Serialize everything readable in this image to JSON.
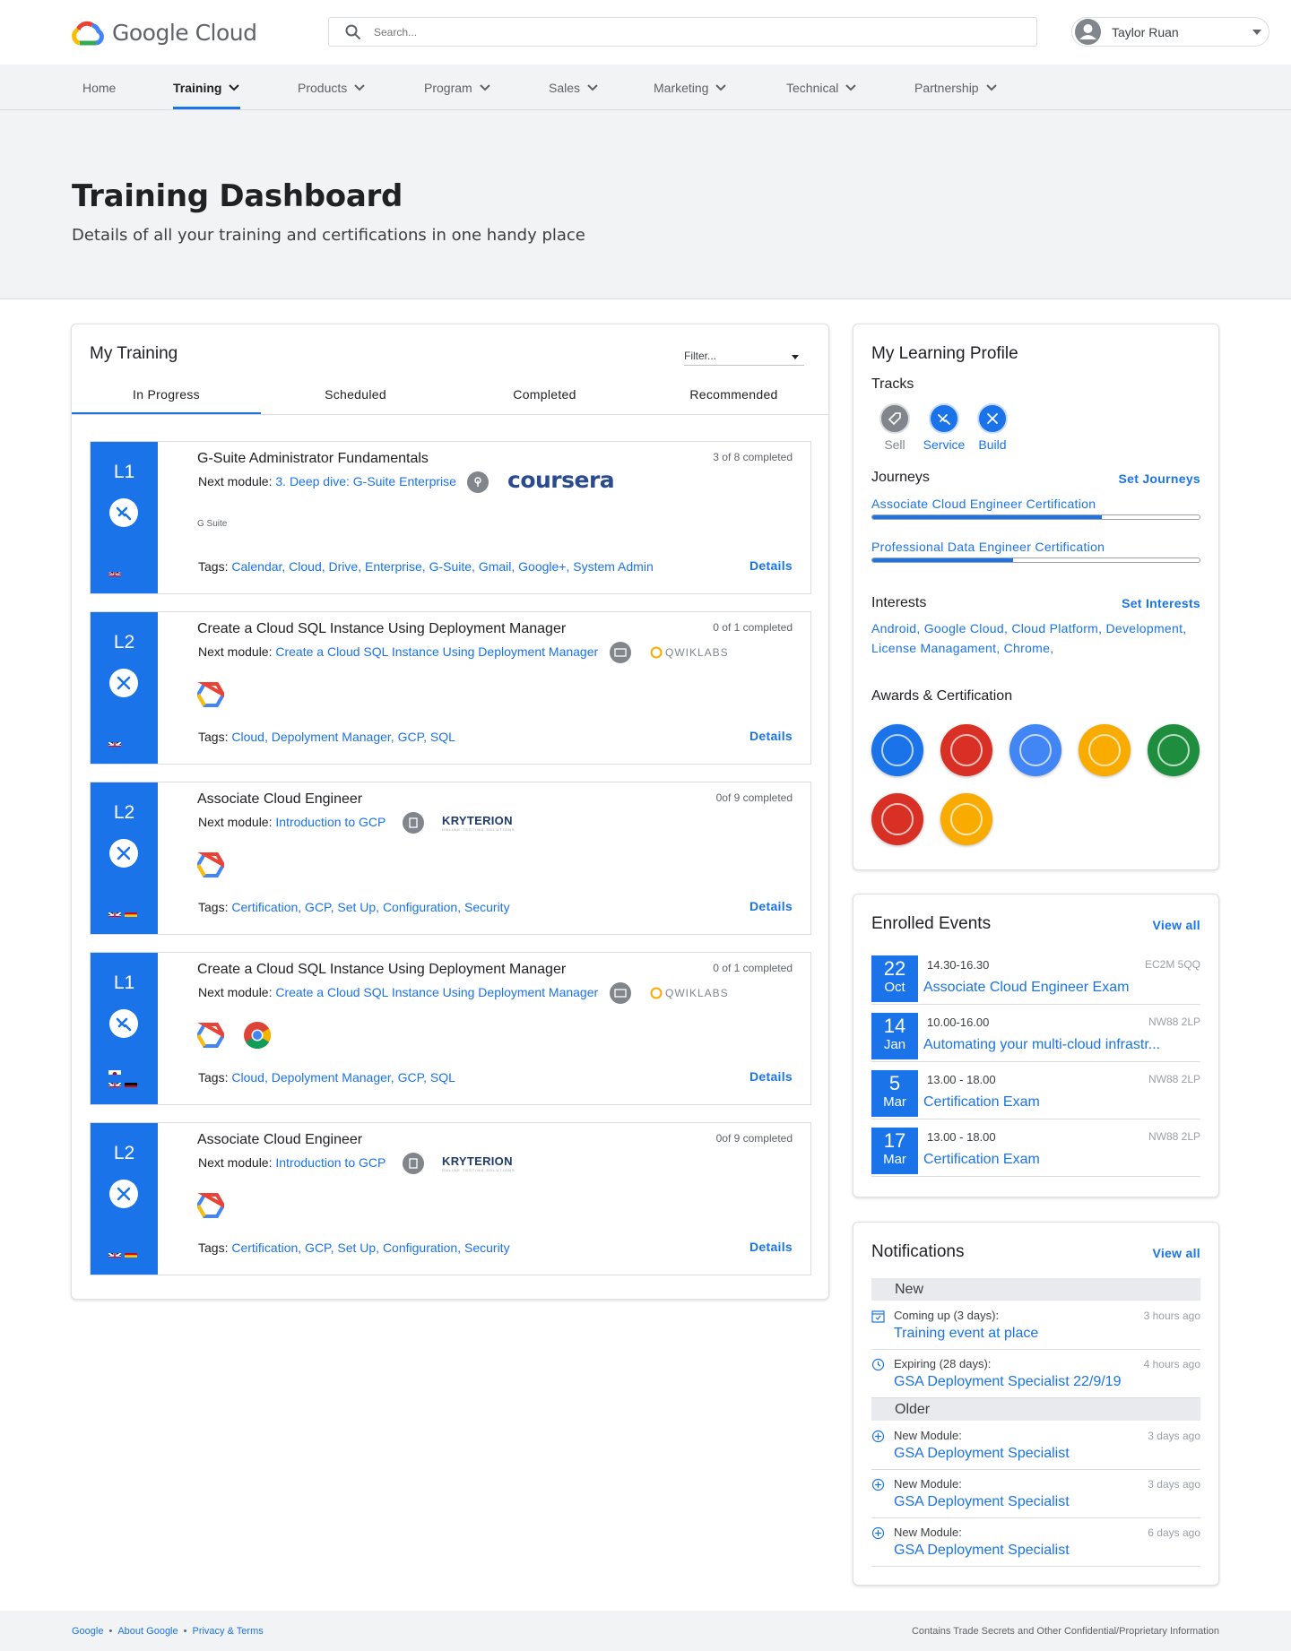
{
  "header": {
    "brand": "Google Cloud",
    "search_placeholder": "Search...",
    "user_name": "Taylor Ruan"
  },
  "nav": {
    "items": [
      {
        "label": "Home",
        "dropdown": false
      },
      {
        "label": "Training",
        "dropdown": true,
        "active": true
      },
      {
        "label": "Products",
        "dropdown": true
      },
      {
        "label": "Program",
        "dropdown": true
      },
      {
        "label": "Sales",
        "dropdown": true
      },
      {
        "label": "Marketing",
        "dropdown": true
      },
      {
        "label": "Technical",
        "dropdown": true
      },
      {
        "label": "Partnership",
        "dropdown": true
      }
    ]
  },
  "hero": {
    "title": "Training Dashboard",
    "subtitle": "Details of all your training and certifications in one handy place"
  },
  "my_training": {
    "title": "My Training",
    "filter_placeholder": "Filter...",
    "tabs": [
      "In Progress",
      "Scheduled",
      "Completed",
      "Recommended"
    ],
    "active_tab": "In Progress",
    "next_module_label": "Next module:",
    "tags_label": "Tags:",
    "details_label": "Details",
    "courses": [
      {
        "level": "L1",
        "title": "G-Suite Administrator Fundamentals",
        "next_module": "3. Deep dive: G-Suite Enterprise",
        "progress": "3 of 8 completed",
        "provider": "coursera",
        "product": "G Suite",
        "tags": "Calendar, Cloud, Drive, Enterprise, G-Suite, Gmail, Google+, System Admin"
      },
      {
        "level": "L2",
        "title": "Create a Cloud SQL Instance Using Deployment Manager",
        "next_module": "Create a Cloud SQL Instance Using Deployment Manager",
        "progress": "0 of 1 completed",
        "provider": "QWIKLABS",
        "tags": "Cloud, Depolyment Manager, GCP, SQL"
      },
      {
        "level": "L2",
        "title": "Associate Cloud Engineer",
        "next_module": "Introduction to GCP",
        "progress": "0of 9 completed",
        "provider": "KRYTERION",
        "provider_sub": "ONLINE TESTING SOLUTIONS",
        "tags": "Certification, GCP, Set Up, Configuration, Security"
      },
      {
        "level": "L1",
        "title": "Create a Cloud SQL Instance Using Deployment Manager",
        "next_module": "Create a Cloud SQL Instance Using Deployment Manager",
        "progress": "0 of 1 completed",
        "provider": "QWIKLABS",
        "tags": "Cloud, Depolyment Manager, GCP, SQL"
      },
      {
        "level": "L2",
        "title": "Associate Cloud Engineer",
        "next_module": "Introduction to GCP",
        "progress": "0of 9 completed",
        "provider": "KRYTERION",
        "provider_sub": "ONLINE TESTING SOLUTIONS",
        "tags": "Certification, GCP, Set Up, Configuration, Security"
      }
    ]
  },
  "learning_profile": {
    "title": "My Learning Profile",
    "tracks_label": "Tracks",
    "tracks": [
      {
        "label": "Sell",
        "active": false
      },
      {
        "label": "Service",
        "active": true
      },
      {
        "label": "Build",
        "active": true
      }
    ],
    "journeys_label": "Journeys",
    "set_journeys": "Set Journeys",
    "journeys": [
      {
        "name": "Associate Cloud Engineer Certification",
        "progress": 0.7
      },
      {
        "name": "Professional Data Engineer Certification",
        "progress": 0.43
      }
    ],
    "interests_label": "Interests",
    "set_interests": "Set Interests",
    "interests": "Android, Google Cloud, Cloud Platform, Development, License Managament, Chrome,",
    "awards_label": "Awards & Certification",
    "award_colors": [
      "#1a73e8",
      "#d93025",
      "#4285f4",
      "#f9ab00",
      "#1e8e3e",
      "#d93025",
      "#f9ab00"
    ]
  },
  "events": {
    "title": "Enrolled Events",
    "view_all": "View all",
    "items": [
      {
        "day": "22",
        "month": "Oct",
        "time": "14.30-16.30",
        "code": "EC2M 5QQ",
        "name": "Associate Cloud Engineer Exam"
      },
      {
        "day": "14",
        "month": "Jan",
        "time": "10.00-16.00",
        "code": "NW88 2LP",
        "name": "Automating your multi-cloud infrastr..."
      },
      {
        "day": "5",
        "month": "Mar",
        "time": "13.00 - 18.00",
        "code": "NW88 2LP",
        "name": "Certification Exam"
      },
      {
        "day": "17",
        "month": "Mar",
        "time": "13.00 - 18.00",
        "code": "NW88 2LP",
        "name": "Certification Exam"
      }
    ]
  },
  "notifications": {
    "title": "Notifications",
    "view_all": "View all",
    "new_label": "New",
    "older_label": "Older",
    "new_items": [
      {
        "icon": "calendar-icon",
        "title": "Coming up (3 days):",
        "link": "Training event at place",
        "ago": "3 hours ago"
      },
      {
        "icon": "expiring-icon",
        "title": "Expiring (28 days):",
        "link": "GSA Deployment Specialist 22/9/19",
        "ago": "4 hours ago"
      }
    ],
    "older_items": [
      {
        "icon": "add-circle-icon",
        "title": "New Module:",
        "link": "GSA Deployment Specialist",
        "ago": "3 days ago"
      },
      {
        "icon": "add-circle-icon",
        "title": "New Module:",
        "link": "GSA Deployment Specialist",
        "ago": "3 days ago"
      },
      {
        "icon": "add-circle-icon",
        "title": "New Module:",
        "link": "GSA Deployment Specialist",
        "ago": "6 days ago"
      }
    ]
  },
  "footer": {
    "links": [
      "Google",
      "About Google",
      "Privacy & Terms"
    ],
    "notice": "Contains Trade Secrets and Other Confidential/Proprietary Information"
  }
}
